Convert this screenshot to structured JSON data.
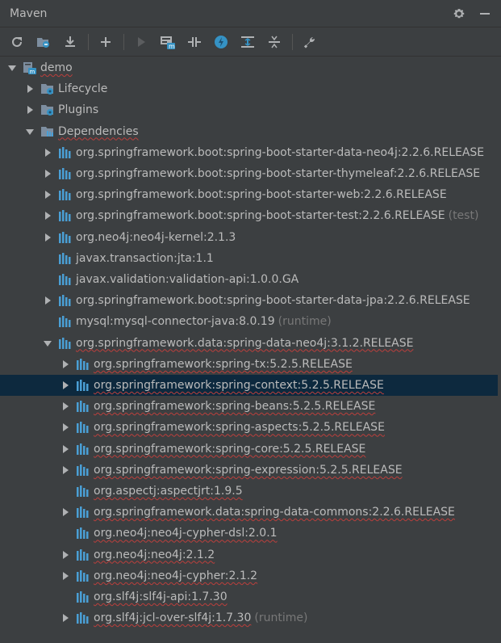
{
  "header": {
    "title": "Maven"
  },
  "toolbar": {
    "buttons": [
      {
        "name": "reload-all-icon"
      },
      {
        "name": "generate-sources-icon"
      },
      {
        "name": "download-sources-icon"
      },
      {
        "name": "add-project-icon"
      },
      {
        "name": "run-icon"
      },
      {
        "name": "execute-goal-icon"
      },
      {
        "name": "toggle-offline-icon"
      },
      {
        "name": "skip-tests-icon"
      },
      {
        "name": "show-dependencies-icon"
      },
      {
        "name": "collapse-all-icon"
      },
      {
        "name": "settings-wrench-icon"
      }
    ]
  },
  "tree": {
    "rows": [
      {
        "label": "demo",
        "suffix": "",
        "level": 0,
        "expander": "expanded",
        "icon": "maven-project",
        "squiggle": true,
        "selected": false
      },
      {
        "label": "Lifecycle",
        "suffix": "",
        "level": 1,
        "expander": "collapsed",
        "icon": "folder-gear",
        "squiggle": false,
        "selected": false
      },
      {
        "label": "Plugins",
        "suffix": "",
        "level": 1,
        "expander": "collapsed",
        "icon": "folder-gear",
        "squiggle": false,
        "selected": false
      },
      {
        "label": "Dependencies",
        "suffix": "",
        "level": 1,
        "expander": "expanded",
        "icon": "folder-deps",
        "squiggle": true,
        "selected": false
      },
      {
        "label": "org.springframework.boot:spring-boot-starter-data-neo4j:2.2.6.RELEASE",
        "suffix": "",
        "level": 2,
        "expander": "collapsed",
        "icon": "library",
        "squiggle": false,
        "selected": false
      },
      {
        "label": "org.springframework.boot:spring-boot-starter-thymeleaf:2.2.6.RELEASE",
        "suffix": "",
        "level": 2,
        "expander": "collapsed",
        "icon": "library",
        "squiggle": false,
        "selected": false
      },
      {
        "label": "org.springframework.boot:spring-boot-starter-web:2.2.6.RELEASE",
        "suffix": "",
        "level": 2,
        "expander": "collapsed",
        "icon": "library",
        "squiggle": false,
        "selected": false
      },
      {
        "label": "org.springframework.boot:spring-boot-starter-test:2.2.6.RELEASE",
        "suffix": "(test)",
        "level": 2,
        "expander": "collapsed",
        "icon": "library",
        "squiggle": false,
        "selected": false
      },
      {
        "label": "org.neo4j:neo4j-kernel:2.1.3",
        "suffix": "",
        "level": 2,
        "expander": "collapsed",
        "icon": "library",
        "squiggle": false,
        "selected": false
      },
      {
        "label": "javax.transaction:jta:1.1",
        "suffix": "",
        "level": 2,
        "expander": "none",
        "icon": "library",
        "squiggle": false,
        "selected": false
      },
      {
        "label": "javax.validation:validation-api:1.0.0.GA",
        "suffix": "",
        "level": 2,
        "expander": "none",
        "icon": "library",
        "squiggle": false,
        "selected": false
      },
      {
        "label": "org.springframework.boot:spring-boot-starter-data-jpa:2.2.6.RELEASE",
        "suffix": "",
        "level": 2,
        "expander": "collapsed",
        "icon": "library",
        "squiggle": false,
        "selected": false
      },
      {
        "label": "mysql:mysql-connector-java:8.0.19",
        "suffix": "(runtime)",
        "level": 2,
        "expander": "none",
        "icon": "library",
        "squiggle": false,
        "selected": false
      },
      {
        "label": "org.springframework.data:spring-data-neo4j:3.1.2.RELEASE",
        "suffix": "",
        "level": 2,
        "expander": "expanded",
        "icon": "library",
        "squiggle": true,
        "selected": false
      },
      {
        "label": "org.springframework:spring-tx:5.2.5.RELEASE",
        "suffix": "",
        "level": 3,
        "expander": "collapsed",
        "icon": "library",
        "squiggle": true,
        "selected": false
      },
      {
        "label": "org.springframework:spring-context:5.2.5.RELEASE",
        "suffix": "",
        "level": 3,
        "expander": "collapsed",
        "icon": "library",
        "squiggle": true,
        "selected": true
      },
      {
        "label": "org.springframework:spring-beans:5.2.5.RELEASE",
        "suffix": "",
        "level": 3,
        "expander": "collapsed",
        "icon": "library",
        "squiggle": true,
        "selected": false
      },
      {
        "label": "org.springframework:spring-aspects:5.2.5.RELEASE",
        "suffix": "",
        "level": 3,
        "expander": "collapsed",
        "icon": "library",
        "squiggle": true,
        "selected": false
      },
      {
        "label": "org.springframework:spring-core:5.2.5.RELEASE",
        "suffix": "",
        "level": 3,
        "expander": "collapsed",
        "icon": "library",
        "squiggle": true,
        "selected": false
      },
      {
        "label": "org.springframework:spring-expression:5.2.5.RELEASE",
        "suffix": "",
        "level": 3,
        "expander": "collapsed",
        "icon": "library",
        "squiggle": true,
        "selected": false
      },
      {
        "label": "org.aspectj:aspectjrt:1.9.5",
        "suffix": "",
        "level": 3,
        "expander": "none",
        "icon": "library",
        "squiggle": true,
        "selected": false
      },
      {
        "label": "org.springframework.data:spring-data-commons:2.2.6.RELEASE",
        "suffix": "",
        "level": 3,
        "expander": "collapsed",
        "icon": "library",
        "squiggle": true,
        "selected": false
      },
      {
        "label": "org.neo4j:neo4j-cypher-dsl:2.0.1",
        "suffix": "",
        "level": 3,
        "expander": "none",
        "icon": "library",
        "squiggle": true,
        "selected": false
      },
      {
        "label": "org.neo4j:neo4j:2.1.2",
        "suffix": "",
        "level": 3,
        "expander": "collapsed",
        "icon": "library",
        "squiggle": true,
        "selected": false
      },
      {
        "label": "org.neo4j:neo4j-cypher:2.1.2",
        "suffix": "",
        "level": 3,
        "expander": "collapsed",
        "icon": "library",
        "squiggle": true,
        "selected": false
      },
      {
        "label": "org.slf4j:slf4j-api:1.7.30",
        "suffix": "",
        "level": 3,
        "expander": "none",
        "icon": "library",
        "squiggle": true,
        "selected": false
      },
      {
        "label": "org.slf4j:jcl-over-slf4j:1.7.30",
        "suffix": "(runtime)",
        "level": 3,
        "expander": "collapsed",
        "icon": "library",
        "squiggle": true,
        "selected": false
      }
    ]
  },
  "colors": {
    "background": "#3c3f41",
    "selection": "#0d293e",
    "text": "#bbbbbb",
    "muted": "#787878",
    "squiggle": "#bc3f3c",
    "library_bars": "#4a9fd5"
  }
}
